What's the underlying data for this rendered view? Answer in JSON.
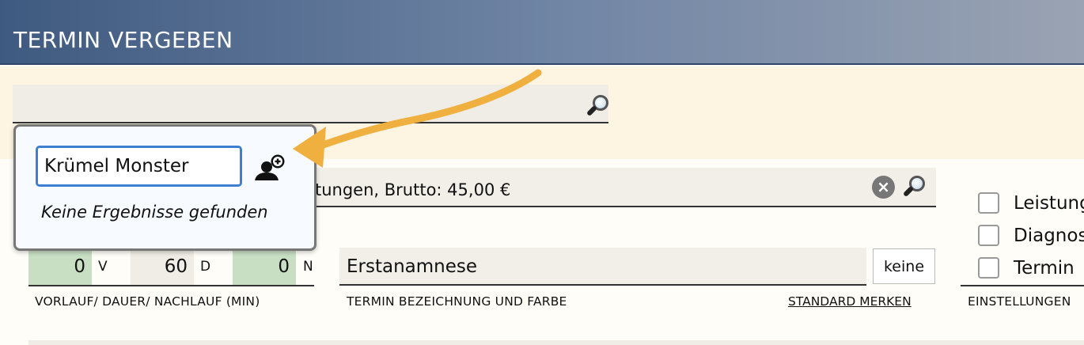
{
  "header": {
    "title": "TERMIN VERGEBEN"
  },
  "top_search": {
    "value": "",
    "icon": "magnifier-icon"
  },
  "services": {
    "text": "tungen, Brutto: 45,00 €"
  },
  "popup": {
    "input_value": "Krümel Monster",
    "add_person_icon": "add-person-icon",
    "no_results": "Keine Ergebnisse gefunden"
  },
  "checkboxes": [
    {
      "label": "Leistung",
      "checked": false
    },
    {
      "label": "Diagnos",
      "checked": false
    },
    {
      "label": "Termin",
      "checked": false
    }
  ],
  "timing": {
    "vorlauf": "0",
    "vorlauf_unit": "V",
    "dauer": "60",
    "dauer_unit": "D",
    "nachlauf": "0",
    "nachlauf_unit": "N",
    "label": "VORLAUF/ DAUER/ NACHLAUF (MIN)"
  },
  "termin": {
    "name": "Erstanamnese",
    "color_button": "keine",
    "label": "TERMIN BEZEICHNUNG UND FARBE",
    "standard_link": "STANDARD MERKEN"
  },
  "settings_label": "EINSTELLUNGEN",
  "colors": {
    "header_start": "#3f5a80",
    "header_end": "#9aa3b3",
    "accent_arrow": "#f0b040",
    "field_green": "#c8dfc4",
    "input_focus": "#3d7fd1"
  }
}
